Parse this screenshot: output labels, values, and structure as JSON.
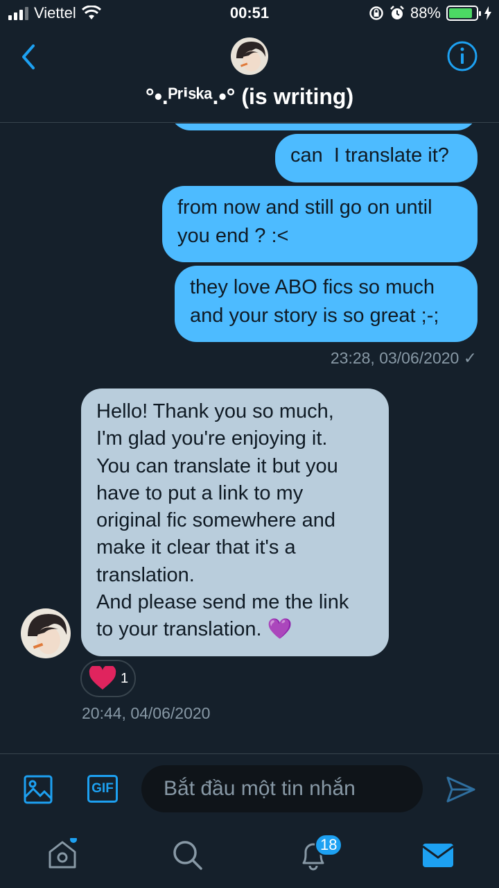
{
  "status_bar": {
    "carrier": "Viettel",
    "time": "00:51",
    "battery_percent": "88%",
    "battery_level": 0.88
  },
  "header": {
    "title": "°•.ᴾʳⁱˢᵏᵃ.•° (is writing)"
  },
  "messages": {
    "outgoing": [
      {
        "text": "can  I translate it?"
      },
      {
        "text": "from now and still go on until you end ? :<"
      },
      {
        "text": "they love ABO fics so much and your story is so great ;-;"
      }
    ],
    "outgoing_timestamp": "23:28, 03/06/2020 ✓",
    "incoming": {
      "lines": [
        "Hello! Thank you so much,",
        "I'm glad you're enjoying it.",
        "You can translate it but you",
        "have to put a link to my",
        "original fic somewhere and",
        "make it clear that it's a",
        "translation.",
        "And please send me the link",
        "to your translation. 💜"
      ],
      "reaction_count": "1",
      "timestamp": "20:44, 04/06/2020"
    }
  },
  "composer": {
    "placeholder": "Bắt đầu một tin nhắn",
    "gif_label": "GIF"
  },
  "nav": {
    "notifications_badge": "18"
  },
  "colors": {
    "background": "#15202b",
    "outgoing_bubble": "#4dbbff",
    "incoming_bubble": "#b9cddc",
    "accent": "#1da1f2"
  }
}
